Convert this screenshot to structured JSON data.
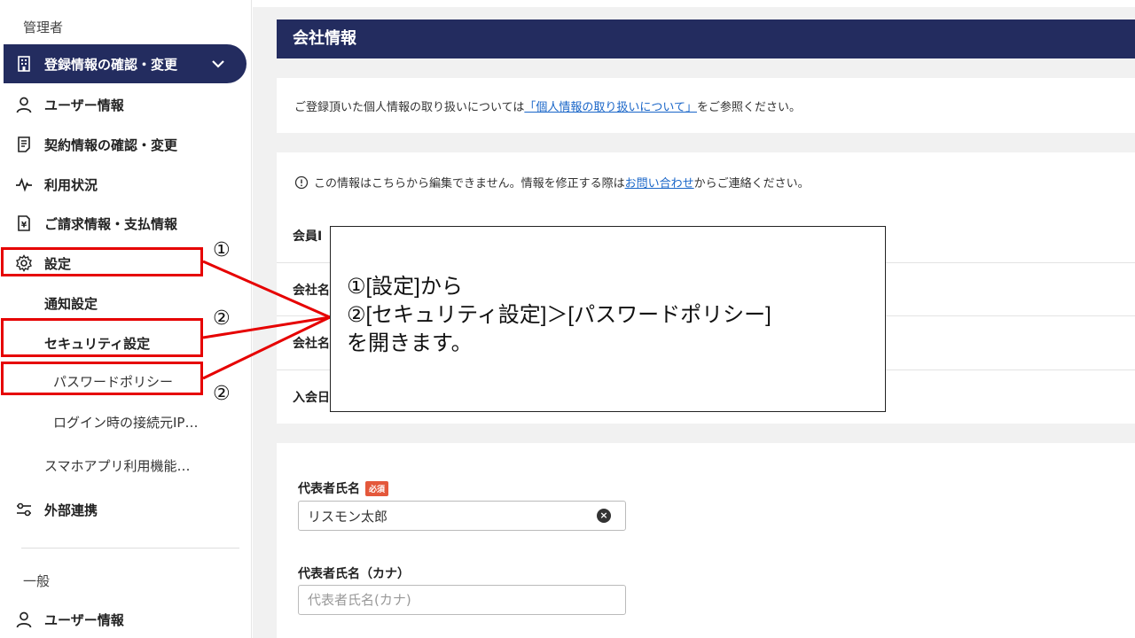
{
  "sidebar": {
    "section_admin": "管理者",
    "section_general": "一般",
    "items": [
      {
        "label": "登録情報の確認・変更",
        "icon": "building-icon"
      },
      {
        "label": "ユーザー情報",
        "icon": "user-icon"
      },
      {
        "label": "契約情報の確認・変更",
        "icon": "document-icon"
      },
      {
        "label": "利用状況",
        "icon": "activity-icon"
      },
      {
        "label": "ご請求情報・支払情報",
        "icon": "invoice-icon"
      },
      {
        "label": "設定",
        "icon": "gear-icon"
      },
      {
        "label": "外部連携",
        "icon": "link-settings-icon"
      },
      {
        "label": "ユーザー情報",
        "icon": "user-icon"
      }
    ],
    "settings_sub": {
      "notification": "通知設定",
      "security": "セキュリティ設定",
      "password_policy": "パスワードポリシー",
      "login_ip": "ログイン時の接続元IP…",
      "smartphone": "スマホアプリ利用機能…"
    }
  },
  "main": {
    "title": "会社情報",
    "privacy_notice": {
      "before": "ご登録頂いた個人情報の取り扱いについては",
      "link": "「個人情報の取り扱いについて」",
      "after": "をご参照ください。"
    },
    "edit_notice": {
      "before": "この情報はこちらから編集できません。情報を修正する際は",
      "link": "お問い合わせ",
      "after": "からご連絡ください。"
    },
    "rows": [
      "会員I",
      "会社名",
      "会社名",
      "入会日"
    ],
    "form": {
      "rep_name_label": "代表者氏名",
      "required_badge": "必須",
      "rep_name_value": "リスモン太郎",
      "rep_kana_label": "代表者氏名（カナ）",
      "rep_kana_placeholder": "代表者氏名(カナ)"
    }
  },
  "callout": {
    "line1": "①[設定]から",
    "line2": "②[セキュリティ設定]＞[パスワードポリシー]",
    "line3": "を開きます。"
  },
  "markers": {
    "m1": "①",
    "m2a": "②",
    "m2b": "②"
  },
  "colors": {
    "sidebar_active": "#232c5f",
    "header": "#232c5f",
    "highlight": "#e60000",
    "link": "#1a66c8",
    "required": "#e4583b"
  }
}
